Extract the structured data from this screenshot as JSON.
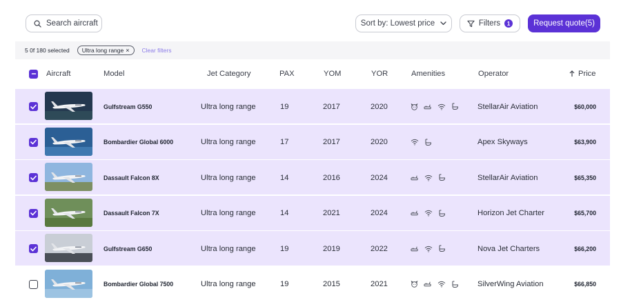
{
  "search": {
    "placeholder": "Search aircraft"
  },
  "sort": {
    "label": "Sort by: Lowest price"
  },
  "filters": {
    "label": "Filters",
    "count": "1"
  },
  "request": {
    "label": "Request quote(5)"
  },
  "selection": {
    "count_text": "5 0f 180 selected",
    "chip_label": "Ultra long range",
    "clear_label": "Clear filters"
  },
  "table": {
    "headers": {
      "aircraft": "Aircraft",
      "model": "Model",
      "category": "Jet Category",
      "pax": "PAX",
      "yom": "YOM",
      "yor": "YOR",
      "amenities": "Amenities",
      "operator": "Operator",
      "price": "Price"
    },
    "rows": [
      {
        "selected": true,
        "model": "Gulfstream G550",
        "category": "Ultra long range",
        "pax": "19",
        "yom": "2017",
        "yor": "2020",
        "amenities": [
          "pet-icon",
          "seat-icon",
          "wifi-icon",
          "lavatory-icon"
        ],
        "operator": "StellarAir Aviation",
        "price": "$60,000",
        "sky": "#24384f",
        "ground": "#2e4a58"
      },
      {
        "selected": true,
        "model": "Bombardier Global 6000",
        "category": "Ultra long range",
        "pax": "17",
        "yom": "2017",
        "yor": "2020",
        "amenities": [
          "wifi-icon",
          "lavatory-icon"
        ],
        "operator": "Apex Skyways",
        "price": "$63,900",
        "sky": "#2b5f95",
        "ground": "#3f79b0"
      },
      {
        "selected": true,
        "model": "Dassault Falcon 8X",
        "category": "Ultra long range",
        "pax": "14",
        "yom": "2016",
        "yor": "2024",
        "amenities": [
          "seat-icon",
          "wifi-icon",
          "lavatory-icon"
        ],
        "operator": "StellarAir Aviation",
        "price": "$65,350",
        "sky": "#8fb6df",
        "ground": "#7d8f63"
      },
      {
        "selected": true,
        "model": "Dassault Falcon 7X",
        "category": "Ultra long range",
        "pax": "14",
        "yom": "2021",
        "yor": "2024",
        "amenities": [
          "seat-icon",
          "wifi-icon",
          "lavatory-icon"
        ],
        "operator": "Horizon Jet Charter",
        "price": "$65,700",
        "sky": "#6f8f5a",
        "ground": "#59793f"
      },
      {
        "selected": true,
        "model": "Gulfstream G650",
        "category": "Ultra long range",
        "pax": "19",
        "yom": "2019",
        "yor": "2022",
        "amenities": [
          "seat-icon",
          "wifi-icon",
          "lavatory-icon"
        ],
        "operator": "Nova Jet Charters",
        "price": "$66,200",
        "sky": "#c9ced6",
        "ground": "#4a4f57"
      },
      {
        "selected": false,
        "model": "Bombardier Global 7500",
        "category": "Ultra long range",
        "pax": "19",
        "yom": "2015",
        "yor": "2021",
        "amenities": [
          "pet-icon",
          "seat-icon",
          "wifi-icon",
          "lavatory-icon"
        ],
        "operator": "SilverWing Aviation",
        "price": "$66,850",
        "sky": "#7fb0d8",
        "ground": "#9cc3e2"
      }
    ]
  },
  "colors": {
    "accent": "#5b32d6",
    "row_selected": "#ebe4fd",
    "clear_link": "#8b7be8"
  }
}
